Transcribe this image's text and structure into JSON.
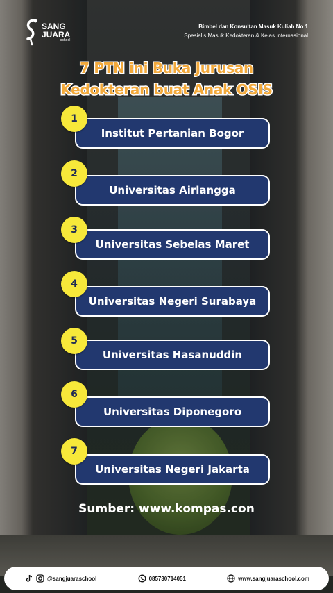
{
  "header": {
    "brand_line1": "SANG",
    "brand_line2": "JUARA",
    "brand_line3": "school",
    "tagline1": "Bimbel dan Konsultan Masuk Kuliah No 1",
    "tagline2": "Spesialis Masuk Kedokteran & Kelas Internasional"
  },
  "title": {
    "line1": "7 PTN ini Buka Jurusan",
    "line2": "Kedokteran buat Anak OSIS"
  },
  "items": [
    {
      "number": "1",
      "label": "Institut Pertanian Bogor"
    },
    {
      "number": "2",
      "label": "Universitas Airlangga"
    },
    {
      "number": "3",
      "label": "Universitas Sebelas Maret"
    },
    {
      "number": "4",
      "label": "Universitas Negeri Surabaya"
    },
    {
      "number": "5",
      "label": "Universitas Hasanuddin"
    },
    {
      "number": "6",
      "label": "Universitas Diponegoro"
    },
    {
      "number": "7",
      "label": "Universitas Negeri Jakarta"
    }
  ],
  "source": "Sumber: www.kompas.con",
  "footer": {
    "social": "@sangjuaraschool",
    "phone": "085730714051",
    "website": "www.sangjuaraschool.com"
  },
  "colors": {
    "title_fill": "#f2a93b",
    "item_bg": "#22386f",
    "number_bg": "#f7e83a"
  },
  "icons": [
    "tiktok-icon",
    "instagram-icon",
    "whatsapp-icon",
    "globe-icon"
  ]
}
